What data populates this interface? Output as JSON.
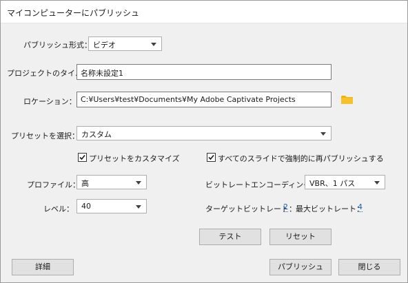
{
  "window": {
    "title": "マイコンピューターにパブリッシュ"
  },
  "form": {
    "format_label": "パブリッシュ形式：",
    "format_value": "ビデオ",
    "project_label": "プロジェクトのタイ...",
    "project_value": "名称未設定1",
    "location_label": "ロケーション：",
    "location_value": "C:¥Users¥test¥Documents¥My Adobe Captivate Projects",
    "preset_label": "プリセットを選択：",
    "preset_value": "カスタム",
    "customize_preset_label": "プリセットをカスタマイズ",
    "customize_preset_checked": true,
    "force_republish_label": "すべてのスライドで強制的に再パブリッシュする",
    "force_republish_checked": true,
    "profile_label": "プロファイル：",
    "profile_value": "高",
    "level_label": "レベル：",
    "level_value": "40",
    "bitrate_encoding_label": "ビットレートエンコーディング：",
    "bitrate_encoding_value": "VBR、1 パス",
    "target_bitrate_label": "ターゲットビットレート：",
    "target_bitrate_value": "2",
    "max_bitrate_label": "最大ビットレート：",
    "max_bitrate_value": "4"
  },
  "buttons": {
    "test": "テスト",
    "reset": "リセット",
    "details": "詳細",
    "publish": "パブリッシュ",
    "close": "閉じる"
  },
  "icons": {
    "folder": "folder-icon"
  },
  "colors": {
    "folder": "#f2b100",
    "link": "#1a5fb4"
  }
}
